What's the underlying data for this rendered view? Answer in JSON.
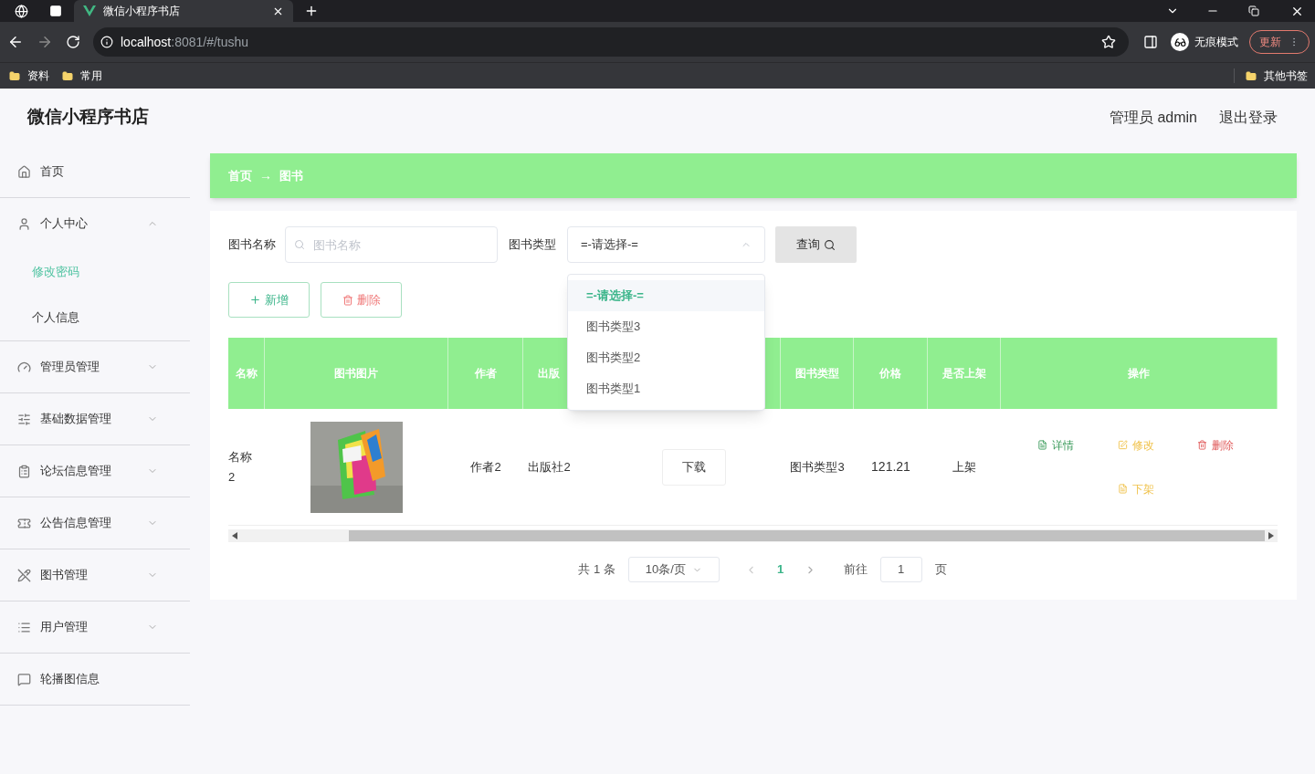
{
  "browser": {
    "tab_title": "微信小程序书店",
    "url_host": "localhost",
    "url_rest": ":8081/#/tushu",
    "incognito": "无痕模式",
    "update": "更新",
    "bookmarks": [
      "资料",
      "常用"
    ],
    "other_bookmarks": "其他书签"
  },
  "header": {
    "title": "微信小程序书店",
    "user": "管理员 admin",
    "logout": "退出登录"
  },
  "sidebar": {
    "items": [
      {
        "label": "首页"
      },
      {
        "label": "个人中心",
        "expanded": true,
        "children": [
          {
            "label": "修改密码",
            "selected": true
          },
          {
            "label": "个人信息",
            "selected": false
          }
        ]
      },
      {
        "label": "管理员管理",
        "expanded": false
      },
      {
        "label": "基础数据管理",
        "expanded": false
      },
      {
        "label": "论坛信息管理",
        "expanded": false
      },
      {
        "label": "公告信息管理",
        "expanded": false
      },
      {
        "label": "图书管理",
        "expanded": false
      },
      {
        "label": "用户管理",
        "expanded": false
      },
      {
        "label": "轮播图信息"
      }
    ]
  },
  "breadcrumb": [
    "首页",
    "图书"
  ],
  "breadcrumb_separator": "→",
  "search": {
    "name_label": "图书名称",
    "name_placeholder": "图书名称",
    "type_label": "图书类型",
    "type_value": "=-请选择-=",
    "open": true,
    "options": [
      {
        "label": "=-请选择-=",
        "selected": true
      },
      {
        "label": "图书类型3",
        "selected": false
      },
      {
        "label": "图书类型2",
        "selected": false
      },
      {
        "label": "图书类型1",
        "selected": false
      }
    ],
    "query": "查询"
  },
  "actions": {
    "add": "新增",
    "delete": "删除"
  },
  "table": {
    "columns": [
      "名称",
      "图书图片",
      "作者",
      "出版",
      "",
      "图书类型",
      "价格",
      "是否上架",
      "操作"
    ],
    "rows": [
      {
        "name": "名称2",
        "author": "作者2",
        "publisher": "出版社2",
        "download": "下载",
        "type": "图书类型3",
        "price": "121.21",
        "status": "上架",
        "ops": [
          "详情",
          "修改",
          "删除",
          "下架"
        ]
      }
    ]
  },
  "pagination": {
    "total": "共 1 条",
    "page_size": "10条/页",
    "pages": [
      {
        "label": "1",
        "selected": true
      }
    ],
    "goto": "前往",
    "goto_value": "1",
    "goto_suffix": "页"
  }
}
